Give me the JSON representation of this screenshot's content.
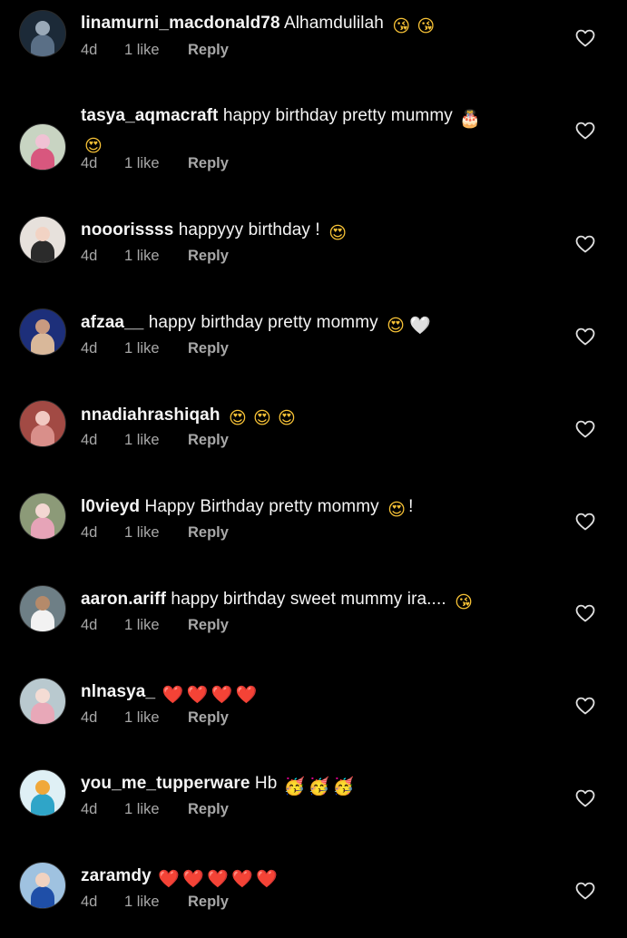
{
  "comments": [
    {
      "username": "linamurni_macdonald78",
      "text": "Alhamdulilah",
      "emojis": [
        "😘",
        "😘"
      ],
      "age": "4d",
      "likes": "1 like",
      "reply": "Reply",
      "avatar_colors": [
        "#1c2a38",
        "#5a6f86",
        "#9aa9b8"
      ]
    },
    {
      "username": "tasya_aqmacraft",
      "text": "happy birthday pretty mummy",
      "emojis": [
        "🎂",
        "😍"
      ],
      "age": "4d",
      "likes": "1 like",
      "reply": "Reply",
      "avatar_colors": [
        "#c8d4c2",
        "#d8577e",
        "#f0c2d4"
      ]
    },
    {
      "username": "nooorissss",
      "text": "happyyy birthday !",
      "emojis": [
        "😍"
      ],
      "age": "4d",
      "likes": "1 like",
      "reply": "Reply",
      "avatar_colors": [
        "#e7e1dc",
        "#2b2b2b",
        "#f2d3c4"
      ]
    },
    {
      "username": "afzaa__",
      "text": "happy birthday pretty mommy",
      "emojis": [
        "😍",
        "🤍"
      ],
      "age": "4d",
      "likes": "1 like",
      "reply": "Reply",
      "avatar_colors": [
        "#1d2f7a",
        "#d9b89a",
        "#c99a80"
      ]
    },
    {
      "username": "nnadiahrashiqah",
      "text": "",
      "emojis": [
        "😍",
        "😍",
        "😍"
      ],
      "age": "4d",
      "likes": "1 like",
      "reply": "Reply",
      "avatar_colors": [
        "#a24a44",
        "#d98f8a",
        "#f1c9c2"
      ]
    },
    {
      "username": "l0vieyd",
      "text": "Happy Birthday pretty mommy",
      "emojis": [
        "😍"
      ],
      "trailing": "!",
      "age": "4d",
      "likes": "1 like",
      "reply": "Reply",
      "avatar_colors": [
        "#8c9a78",
        "#e6a4b8",
        "#f3d7d2"
      ]
    },
    {
      "username": "aaron.ariff",
      "text": "happy birthday sweet mummy ira....",
      "emojis": [
        "😘"
      ],
      "age": "4d",
      "likes": "1 like",
      "reply": "Reply",
      "avatar_colors": [
        "#6e7f86",
        "#f2f2f2",
        "#b58a6a"
      ]
    },
    {
      "username": "nlnasya_",
      "text": "",
      "emojis": [
        "❤️",
        "❤️",
        "❤️",
        "❤️"
      ],
      "age": "4d",
      "likes": "1 like",
      "reply": "Reply",
      "avatar_colors": [
        "#b9c9cf",
        "#e8a8b8",
        "#f4dcd4"
      ]
    },
    {
      "username": "you_me_tupperware",
      "text": "Hb",
      "emojis": [
        "🥳",
        "🥳",
        "🥳"
      ],
      "age": "4d",
      "likes": "1 like",
      "reply": "Reply",
      "avatar_colors": [
        "#dff0f5",
        "#2fa5c8",
        "#f0a83a"
      ]
    },
    {
      "username": "zaramdy",
      "text": "",
      "emojis": [
        "❤️",
        "❤️",
        "❤️",
        "❤️",
        "❤️"
      ],
      "age": "4d",
      "likes": "1 like",
      "reply": "Reply",
      "avatar_colors": [
        "#9fc2e0",
        "#1f4fa8",
        "#f1d2c0"
      ]
    }
  ],
  "emoji_colors": {
    "😘": "#f7c236",
    "😍": "#f7c236",
    "🥳": "#f7c236",
    "🎂": "#f5f5f5",
    "🤍": "#f5f5f5",
    "❤️": "#e8303c"
  },
  "theme": {
    "background": "#000000",
    "text": "#f5f5f5",
    "secondary": "#a8a8a8"
  }
}
